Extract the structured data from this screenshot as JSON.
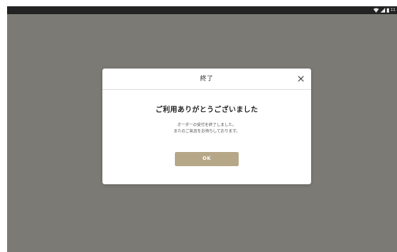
{
  "status_bar": {
    "time": "11",
    "icons": [
      "wifi-icon",
      "signal-icon",
      "battery-icon"
    ]
  },
  "dialog": {
    "title": "終了",
    "heading": "ご利用ありがとうございました",
    "message_line1": "オーダーの受付を終了しました。",
    "message_line2": "またのご来店をお待ちしております。",
    "ok_label": "OK",
    "close_icon": "close-icon"
  },
  "colors": {
    "overlay": "#7b7a74",
    "status_bar": "#232323",
    "ok_button": "#b7a789",
    "dialog_bg": "#ffffff"
  }
}
